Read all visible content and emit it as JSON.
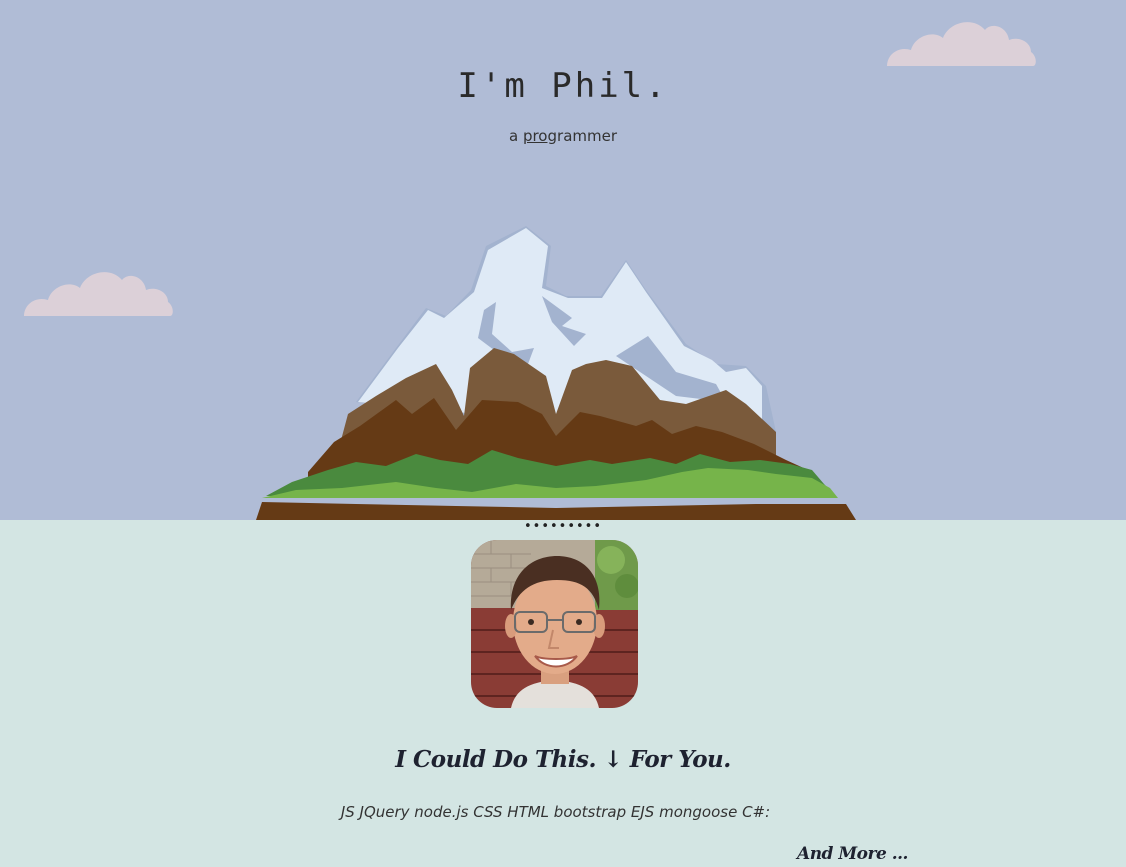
{
  "hero": {
    "title": "I'm Phil.",
    "subtitle_prefix": "a ",
    "subtitle_link": "pro",
    "subtitle_suffix": "grammer"
  },
  "divider": {
    "text": "•••••••••"
  },
  "about": {
    "heading": "I Could Do This. ↓ For You.",
    "skills": "JS JQuery node.js CSS HTML bootstrap EJS mongoose C#:",
    "more_link": "And More ..."
  },
  "colors": {
    "sky": "#b0bcd6",
    "ground": "#d3e5e3",
    "cloud": "#dcd0d8",
    "snow": "#dfeaf6",
    "rock_light": "#7a5a3b",
    "rock_dark": "#653a15",
    "grass_dark": "#4a8a3e",
    "grass_light": "#76b44a"
  },
  "icons": {
    "cloud_left": "cloud-icon",
    "cloud_right": "cloud-icon",
    "mountain": "mountain-illustration",
    "avatar": "profile-photo"
  }
}
